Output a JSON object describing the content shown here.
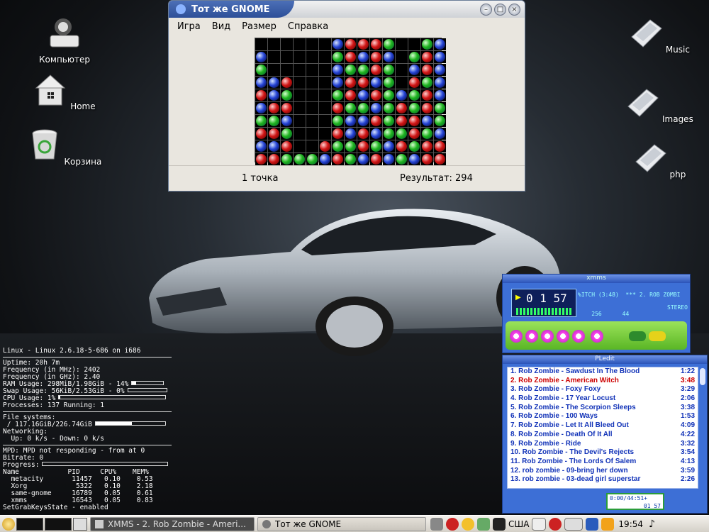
{
  "desktop": {
    "left_icons": [
      {
        "label": "Компьютер",
        "icon": "computer-icon"
      },
      {
        "label": "Home",
        "icon": "home-folder-icon"
      },
      {
        "label": "Корзина",
        "icon": "trash-icon"
      }
    ],
    "right_icons": [
      {
        "label": "Music",
        "icon": "folder-icon"
      },
      {
        "label": "Images",
        "icon": "folder-icon"
      },
      {
        "label": "php",
        "icon": "folder-icon"
      }
    ]
  },
  "window": {
    "title": "Тот же GNOME",
    "menu": [
      {
        "label": "Игра"
      },
      {
        "label": "Вид"
      },
      {
        "label": "Размер"
      },
      {
        "label": "Справка"
      }
    ],
    "status_left": "1 точка",
    "status_right": "Результат: 294",
    "board_rows": [
      "......BRRRG..GB",
      "B.....GRBRB.GRB",
      "G.....BGGRG.BRB",
      "BBR...BRRBG.RGB",
      "RBG...GRBRGBGRB",
      "BRR...RGGBGRGRG",
      "GGB...GBBRGRRBG",
      "RRG...RBRBGGRGB",
      "BBR..RGGRGBRGRR",
      "RRGGGBRGBRBGBRR"
    ],
    "colors": {
      "R": "#d21616",
      "G": "#1fb41f",
      "B": "#2544d6"
    }
  },
  "conky": {
    "header": "Linux - Linux 2.6.18-5-686 on i686",
    "uptime": "Uptime: 20h 7m",
    "freq_mhz": "Frequency (in MHz): 2402",
    "freq_ghz": "Frequency (in GHz): 2.40",
    "ram": "RAM Usage: 298MiB/1.98GiB - 14%",
    "ram_pct": 14,
    "swap": "Swap Usage: 56KiB/2.53GiB - 0%",
    "swap_pct": 0,
    "cpu": "CPU Usage: 1%",
    "cpu_pct": 1,
    "processes": "Processes: 137  Running: 1",
    "fs_label": "File systems:",
    "fs": " / 117.16GiB/226.74GiB",
    "fs_pct": 52,
    "net_label": "Networking:",
    "net": "  Up: 0 k/s - Down: 0 k/s",
    "mpd": "MPD: MPD not responding  -  from  at 0",
    "bitrate": "Bitrate: 0",
    "progress": "Progress:",
    "table_header": "Name            PID     CPU%    MEM%",
    "procs": [
      "  metacity       11457   0.10    0.53",
      "  Xorg            5322   0.10    2.18",
      "  same-gnome     16789   0.05    0.61",
      "  xmms           16543   0.05    0.83"
    ],
    "footer": "SetGrabKeysState - enabled"
  },
  "xmms": {
    "title": "xmms",
    "time": "0 1 57",
    "track": "%ITCH (3:48)  *** 2. ROB ZOMBI",
    "kbps": "256",
    "khz": "44",
    "stereo": "STEREO"
  },
  "playlist": {
    "title": "PLedit",
    "items": [
      {
        "name": "1. Rob Zombie - Sawdust In The Blood",
        "time": "1:22"
      },
      {
        "name": "2. Rob Zombie - American Witch",
        "time": "3:48"
      },
      {
        "name": "3. Rob Zombie - Foxy Foxy",
        "time": "3:29"
      },
      {
        "name": "4. Rob Zombie - 17 Year Locust",
        "time": "2:06"
      },
      {
        "name": "5. Rob Zombie - The Scorpion Sleeps",
        "time": "3:38"
      },
      {
        "name": "6. Rob Zombie - 100 Ways",
        "time": "1:53"
      },
      {
        "name": "7. Rob Zombie - Let It All Bleed Out",
        "time": "4:09"
      },
      {
        "name": "8. Rob Zombie - Death Of It All",
        "time": "4:22"
      },
      {
        "name": "9. Rob Zombie - Ride",
        "time": "3:32"
      },
      {
        "name": "10. Rob Zombie - The Devil's Rejects",
        "time": "3:54"
      },
      {
        "name": "11. Rob Zombie - The Lords Of Salem",
        "time": "4:13"
      },
      {
        "name": "12. rob zombie - 09-bring her down",
        "time": "3:59"
      },
      {
        "name": "13. rob zombie - 03-dead girl superstar",
        "time": "2:26"
      }
    ],
    "current_index": 1,
    "time_display": "0:00/44:51+",
    "small_time": "01 57"
  },
  "taskbar": {
    "tasks": [
      {
        "label": "XMMS - 2. Rob Zombie - Ameri..."
      },
      {
        "label": "Тот же GNOME"
      }
    ],
    "layout": "США",
    "clock": "19:54"
  }
}
